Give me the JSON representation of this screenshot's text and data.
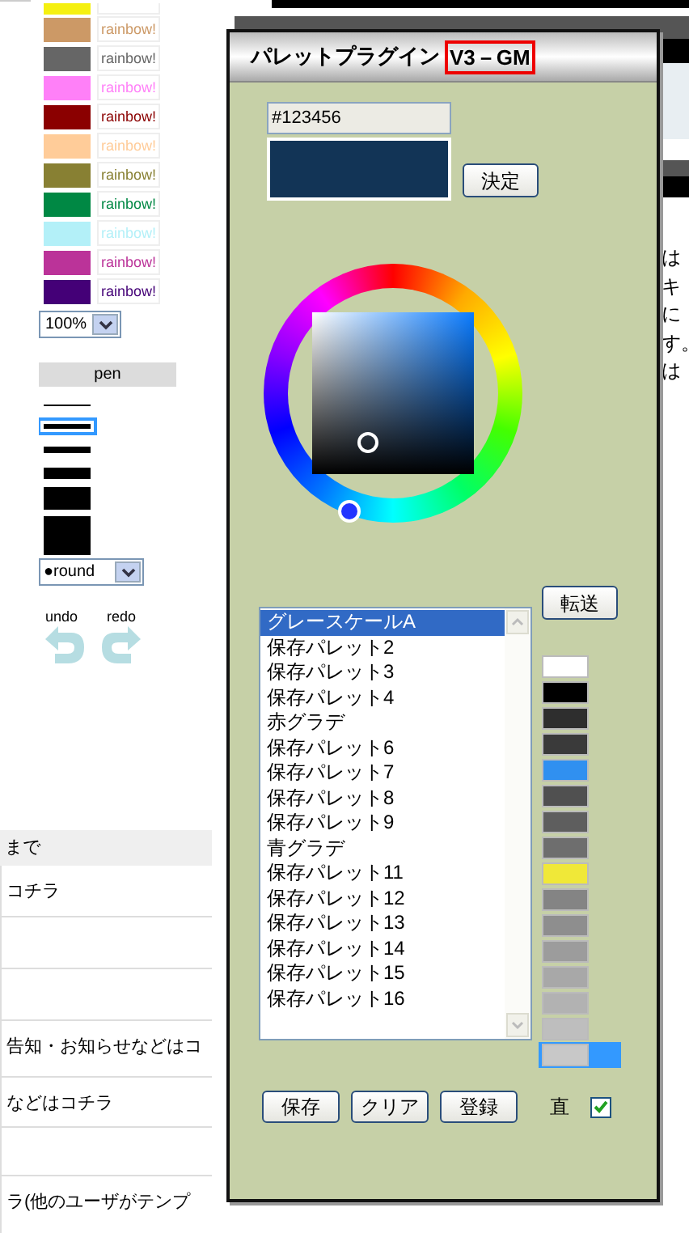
{
  "left_panel": {
    "swatches": [
      {
        "color": "#f5f010"
      },
      {
        "color": "#cc9966",
        "label": "rainbow!"
      },
      {
        "color": "#666666",
        "label": "rainbow!"
      },
      {
        "color": "#ff80f8",
        "label": "rainbow!"
      },
      {
        "color": "#8b0000",
        "label": "rainbow!"
      },
      {
        "color": "#ffcc99",
        "label": "rainbow!"
      },
      {
        "color": "#888033",
        "label": "rainbow!"
      },
      {
        "color": "#008844",
        "label": "rainbow!"
      },
      {
        "color": "#b3f0f8",
        "label": "rainbow!"
      },
      {
        "color": "#bb3399",
        "label": "rainbow!"
      },
      {
        "color": "#440077",
        "label": "rainbow!"
      }
    ],
    "zoom_select": {
      "value": "100%"
    },
    "pen_header": "pen",
    "pens": [
      {
        "selected": false
      },
      {
        "selected": true
      },
      {
        "selected": false
      },
      {
        "selected": false
      },
      {
        "selected": false
      },
      {
        "selected": false
      }
    ],
    "cap_select": {
      "value": "●round"
    },
    "undo": "undo",
    "redo": "redo"
  },
  "page_list": {
    "header": "まで",
    "rows": [
      "コチラ",
      "",
      "",
      "告知・お知らせなどはコ",
      "などはコチラ",
      "",
      "ラ(他のユーザがテンプ"
    ]
  },
  "right_edge": {
    "lines": [
      "は",
      "キ",
      "に",
      "す。",
      "は"
    ]
  },
  "dialog": {
    "title": "パレットプラグイン",
    "version": "V3－GM",
    "color_input": {
      "value": "#123456"
    },
    "apply_button": "決定",
    "send_button": "転送",
    "palettes": [
      {
        "label": "グレースケールA",
        "selected": true
      },
      {
        "label": "保存パレット2",
        "selected": false
      },
      {
        "label": "保存パレット3",
        "selected": false
      },
      {
        "label": "保存パレット4",
        "selected": false
      },
      {
        "label": "赤グラデ",
        "selected": false
      },
      {
        "label": "保存パレット6",
        "selected": false
      },
      {
        "label": "保存パレット7",
        "selected": false
      },
      {
        "label": "保存パレット8",
        "selected": false
      },
      {
        "label": "保存パレット9",
        "selected": false
      },
      {
        "label": "青グラデ",
        "selected": false
      },
      {
        "label": "保存パレット11",
        "selected": false
      },
      {
        "label": "保存パレット12",
        "selected": false
      },
      {
        "label": "保存パレット13",
        "selected": false
      },
      {
        "label": "保存パレット14",
        "selected": false
      },
      {
        "label": "保存パレット15",
        "selected": false
      },
      {
        "label": "保存パレット16",
        "selected": false
      }
    ],
    "colors": [
      {
        "color": "#ffffff",
        "selected": false
      },
      {
        "color": "#000000",
        "selected": false
      },
      {
        "color": "#2e2e2e",
        "selected": false
      },
      {
        "color": "#3a3a3a",
        "selected": false
      },
      {
        "color": "#3090f0",
        "selected": false
      },
      {
        "color": "#505050",
        "selected": false
      },
      {
        "color": "#5e5e5e",
        "selected": false
      },
      {
        "color": "#6e6e6e",
        "selected": false
      },
      {
        "color": "#f0e838",
        "selected": false
      },
      {
        "color": "#848484",
        "selected": false
      },
      {
        "color": "#8e8e8e",
        "selected": false
      },
      {
        "color": "#9c9c9c",
        "selected": false
      },
      {
        "color": "#a8a8a8",
        "selected": false
      },
      {
        "color": "#b2b2b2",
        "selected": false
      },
      {
        "color": "#bebebe",
        "selected": false
      },
      {
        "color": "#c8c8c8",
        "selected": true
      }
    ],
    "buttons": [
      "保存",
      "クリア",
      "登録"
    ],
    "direct": {
      "label": "直",
      "checked": true
    }
  }
}
